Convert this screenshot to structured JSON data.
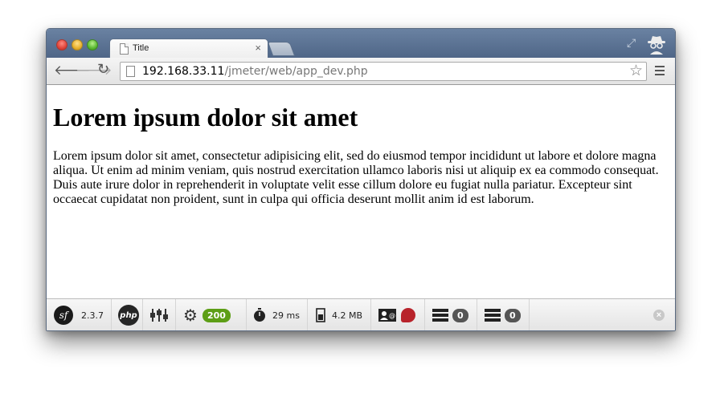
{
  "browser": {
    "tab_title": "Title",
    "tab_close": "×",
    "url_host": "192.168.33.11",
    "url_path": "/jmeter/web/app_dev.php",
    "icons": {
      "back": "arrow-left-icon",
      "forward": "arrow-right-icon",
      "reload": "reload-icon",
      "star": "star-icon",
      "menu": "hamburger-menu-icon",
      "fullscreen": "fullscreen-icon",
      "incognito": "incognito-icon"
    }
  },
  "page": {
    "heading": "Lorem ipsum dolor sit amet",
    "paragraph": "Lorem ipsum dolor sit amet, consectetur adipisicing elit, sed do eiusmod tempor incididunt ut labore et dolore magna aliqua. Ut enim ad minim veniam, quis nostrud exercitation ullamco laboris nisi ut aliquip ex ea commodo consequat. Duis aute irure dolor in reprehenderit in voluptate velit esse cillum dolore eu fugiat nulla pariatur. Excepteur sint occaecat cupidatat non proident, sunt in culpa qui officia deserunt mollit anim id est laborum."
  },
  "debug_toolbar": {
    "symfony_logo": "sf",
    "symfony_version": "2.3.7",
    "php_label": "php",
    "status_code": "200",
    "time": "29 ms",
    "memory": "4.2 MB",
    "db_queries_1": "0",
    "db_queries_2": "0",
    "status_color": "#5d9e16",
    "error_color": "#b8232b"
  }
}
